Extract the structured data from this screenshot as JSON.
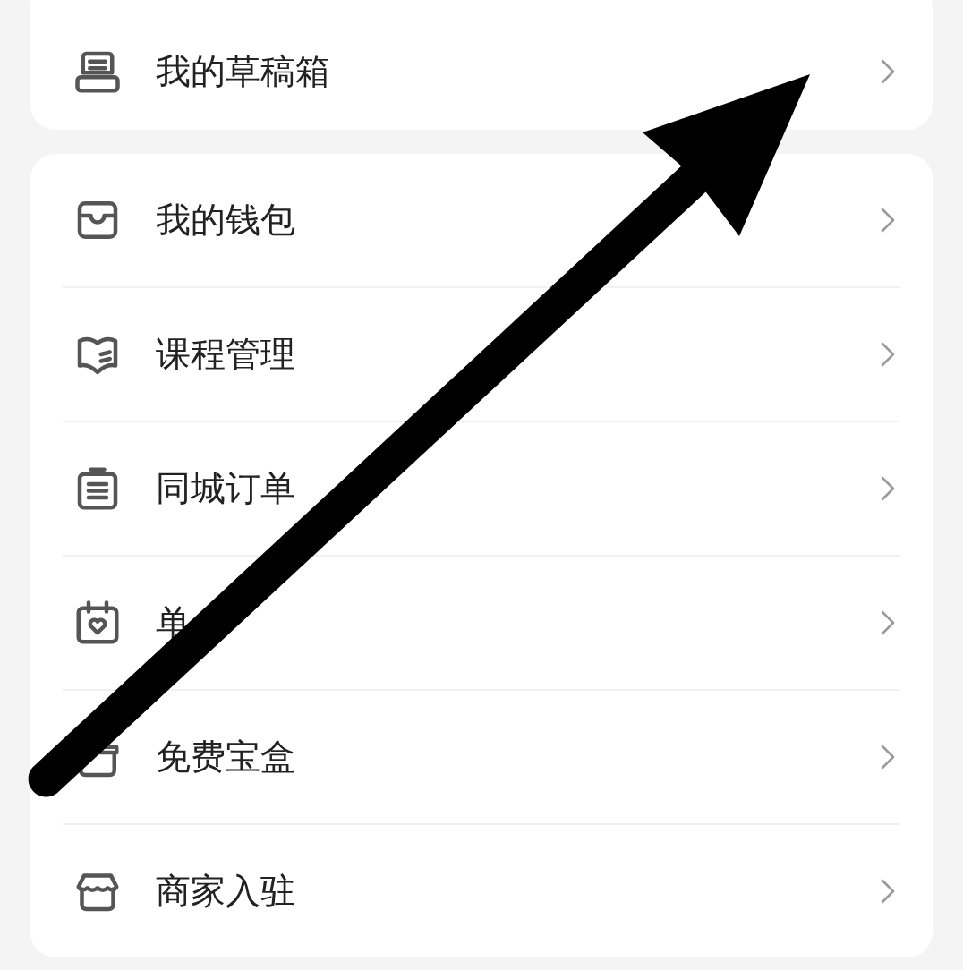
{
  "sections": [
    {
      "items": [
        {
          "label": "我的草稿箱"
        }
      ]
    },
    {
      "items": [
        {
          "label": "我的钱包"
        },
        {
          "label": "课程管理"
        },
        {
          "label": "同城订单"
        },
        {
          "label": "单"
        },
        {
          "label": "免费宝盒"
        },
        {
          "label": "商家入驻"
        }
      ]
    }
  ]
}
